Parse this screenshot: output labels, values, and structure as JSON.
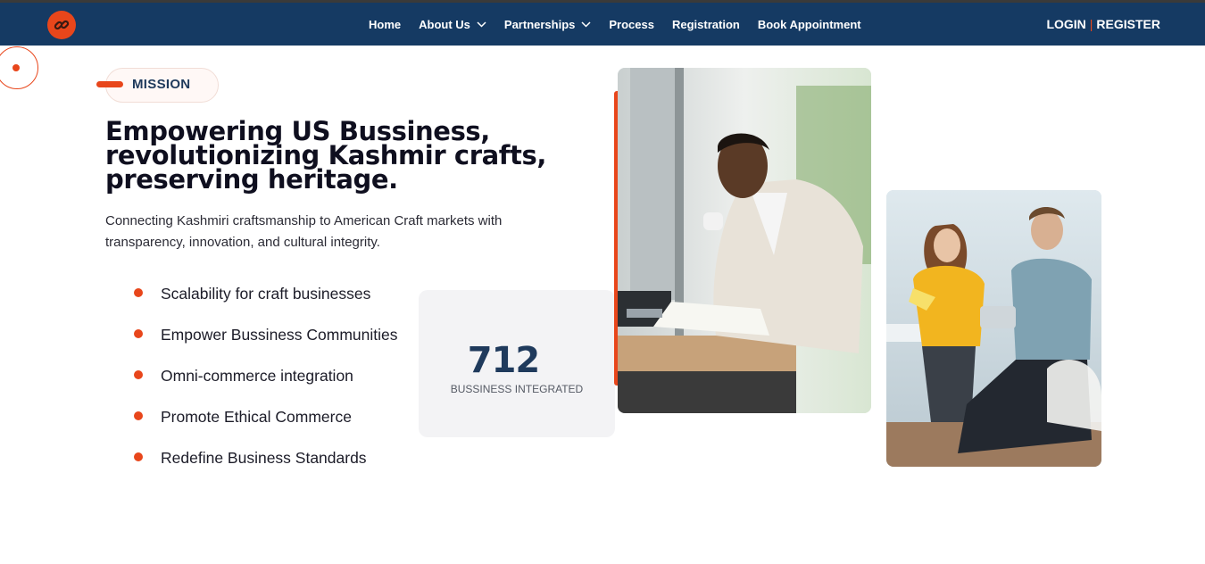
{
  "header": {
    "logo_icon": "chain-link-icon",
    "nav": [
      {
        "label": "Home",
        "has_dropdown": false
      },
      {
        "label": "About Us",
        "has_dropdown": true
      },
      {
        "label": "Partnerships",
        "has_dropdown": true
      },
      {
        "label": "Process",
        "has_dropdown": false
      },
      {
        "label": "Registration",
        "has_dropdown": false
      },
      {
        "label": "Book Appointment",
        "has_dropdown": false
      }
    ],
    "login_label": "LOGIN",
    "separator": "|",
    "register_label": "REGISTER"
  },
  "hero": {
    "badge": "MISSION",
    "heading_lines": [
      "Empowering US Bussiness,",
      "revolutionizing Kashmir crafts,",
      "preserving heritage."
    ],
    "subtext": "Connecting Kashmiri craftsmanship to American Craft markets with transparency, innovation, and cultural integrity.",
    "features": [
      "Scalability for craft businesses",
      "Empower Bussiness Communities",
      "Omni-commerce integration",
      "Promote Ethical Commerce",
      "Redefine Business Standards"
    ],
    "stat": {
      "value": "712",
      "label": "BUSSINESS INTEGRATED"
    }
  },
  "colors": {
    "navbar": "#153a63",
    "accent": "#e8461b",
    "heading": "#0f0f1f",
    "stat_text": "#1f3a5c"
  }
}
